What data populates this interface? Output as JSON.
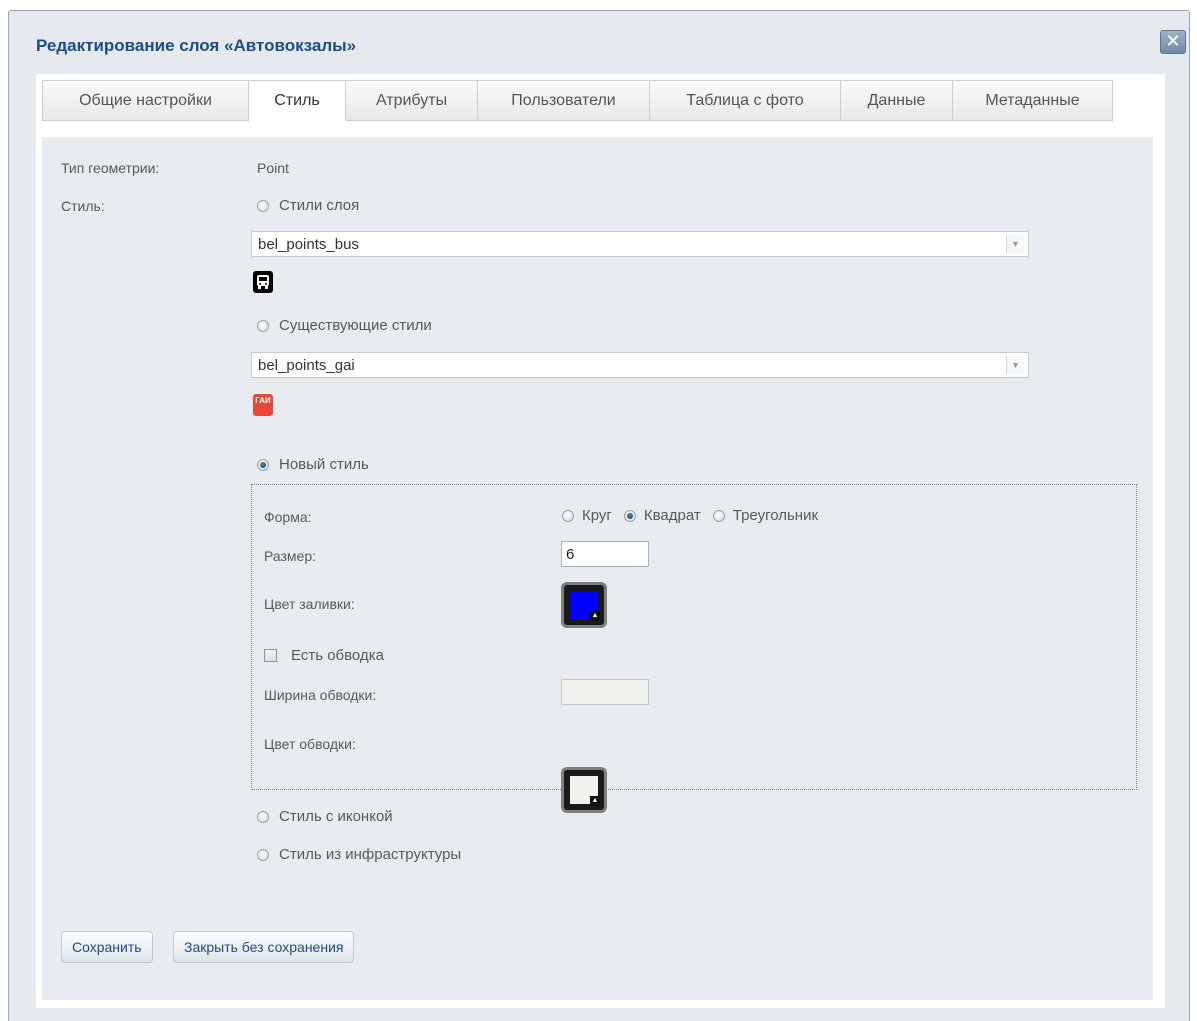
{
  "dialog": {
    "title": "Редактирование слоя «Автовокзалы»",
    "close_label": "✕"
  },
  "tabs": [
    {
      "label": "Общие настройки",
      "active": false
    },
    {
      "label": "Стиль",
      "active": true
    },
    {
      "label": "Атрибуты",
      "active": false
    },
    {
      "label": "Пользователи",
      "active": false
    },
    {
      "label": "Таблица с фото",
      "active": false
    },
    {
      "label": "Данные",
      "active": false
    },
    {
      "label": "Метаданные",
      "active": false
    }
  ],
  "form": {
    "geometry_label": "Тип геометрии:",
    "geometry_value": "Point",
    "style_label": "Стиль:",
    "layer_styles": {
      "label": "Стили слоя",
      "selected": false,
      "select_value": "bel_points_bus",
      "icon": "bus-icon",
      "icon_color": "#000000"
    },
    "existing_styles": {
      "label": "Существующие стили",
      "selected": false,
      "select_value": "bel_points_gai",
      "icon": "gai-icon",
      "icon_text": "ГАИ",
      "icon_color": "#e8473a"
    },
    "new_style": {
      "label": "Новый стиль",
      "selected": true,
      "shape_label": "Форма:",
      "shapes": [
        {
          "label": "Круг",
          "selected": false
        },
        {
          "label": "Квадрат",
          "selected": true
        },
        {
          "label": "Треугольник",
          "selected": false
        }
      ],
      "size_label": "Размер:",
      "size_value": "6",
      "fill_color_label": "Цвет заливки:",
      "fill_color": "#0000ff",
      "has_stroke_label": "Есть обводка",
      "has_stroke": false,
      "stroke_width_label": "Ширина обводки:",
      "stroke_width_value": "",
      "stroke_color_label": "Цвет обводки:",
      "stroke_color": "#f0f0ec"
    },
    "icon_style": {
      "label": "Стиль с иконкой",
      "selected": false
    },
    "infra_style": {
      "label": "Стиль из инфраструктуры",
      "selected": false
    }
  },
  "buttons": {
    "save": "Сохранить",
    "close_without_save": "Закрыть без сохранения"
  },
  "colors": {
    "title": "#1c4d86",
    "content_bg": "#e8ecf0",
    "dialog_bg": "#e6eaee"
  }
}
